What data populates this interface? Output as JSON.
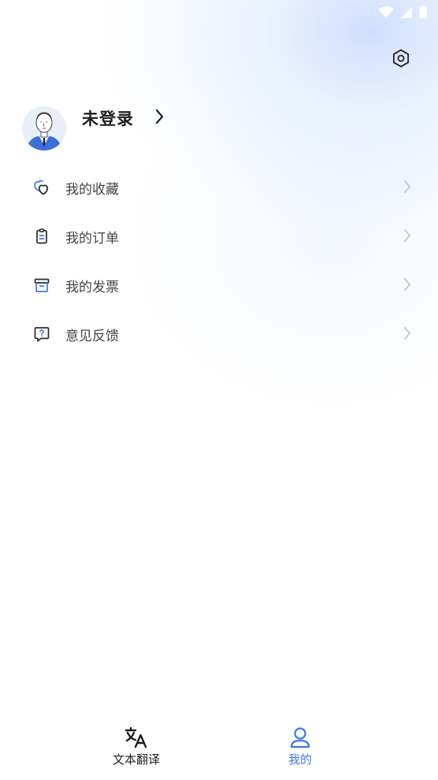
{
  "profile": {
    "name": "未登录"
  },
  "menu": {
    "items": [
      {
        "label": "我的收藏",
        "icon": "heart-cluster-icon"
      },
      {
        "label": "我的订单",
        "icon": "clipboard-icon"
      },
      {
        "label": "我的发票",
        "icon": "archive-box-icon"
      },
      {
        "label": "意见反馈",
        "icon": "feedback-question-icon"
      }
    ]
  },
  "bottom_nav": {
    "tabs": [
      {
        "label": "文本翻译",
        "icon": "translate-icon",
        "active": false
      },
      {
        "label": "我的",
        "icon": "user-icon",
        "active": true
      }
    ]
  },
  "colors": {
    "accent": "#3a7bf0",
    "text_primary": "#1f1f1f",
    "text_secondary": "#444444",
    "chevron": "#c4c4c4"
  },
  "icons": {
    "settings": "hexagon-settings-icon",
    "wifi": "wifi-icon",
    "signal": "signal-icon",
    "battery": "battery-icon"
  }
}
